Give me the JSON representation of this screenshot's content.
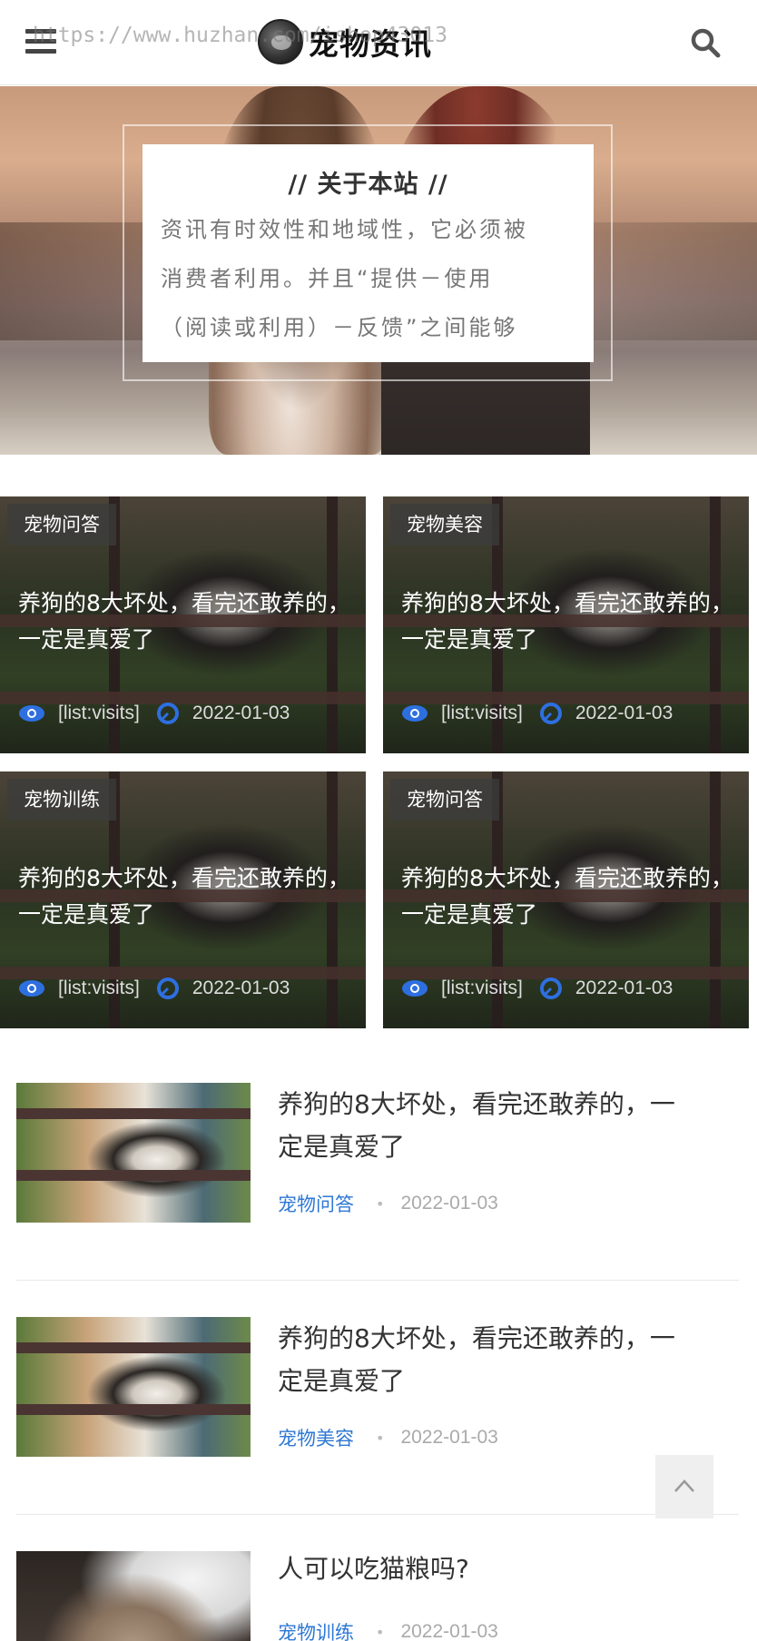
{
  "header": {
    "watermark": "https://www.huzhan.com/ishop43013",
    "logo_text": "宠物资讯",
    "menu_icon": "hamburger-menu-icon",
    "search_icon": "search-icon"
  },
  "banner": {
    "title": "// 关于本站 //",
    "lines": [
      "资讯有时效性和地域性，它必须被",
      "消费者利用。并且“提供－使用",
      "（阅读或利用）－反馈”之间能够"
    ]
  },
  "grid": [
    {
      "category": "宠物问答",
      "title": "养狗的8大坏处，看完还敢养的，一定是真爱了",
      "visits": "[list:visits]",
      "date": "2022-01-03"
    },
    {
      "category": "宠物美容",
      "title": "养狗的8大坏处，看完还敢养的，一定是真爱了",
      "visits": "[list:visits]",
      "date": "2022-01-03"
    },
    {
      "category": "宠物训练",
      "title": "养狗的8大坏处，看完还敢养的，一定是真爱了",
      "visits": "[list:visits]",
      "date": "2022-01-03"
    },
    {
      "category": "宠物问答",
      "title": "养狗的8大坏处，看完还敢养的，一定是真爱了",
      "visits": "[list:visits]",
      "date": "2022-01-03"
    }
  ],
  "list": [
    {
      "title": "养狗的8大坏处，看完还敢养的，一定是真爱了",
      "category": "宠物问答",
      "date": "2022-01-03"
    },
    {
      "title": "养狗的8大坏处，看完还敢养的，一定是真爱了",
      "category": "宠物美容",
      "date": "2022-01-03"
    },
    {
      "title": "人可以吃猫粮吗?",
      "category": "宠物训练",
      "date": "2022-01-03"
    }
  ],
  "colors": {
    "accent": "#2e78d4",
    "eye_icon": "#2e6fe0"
  }
}
